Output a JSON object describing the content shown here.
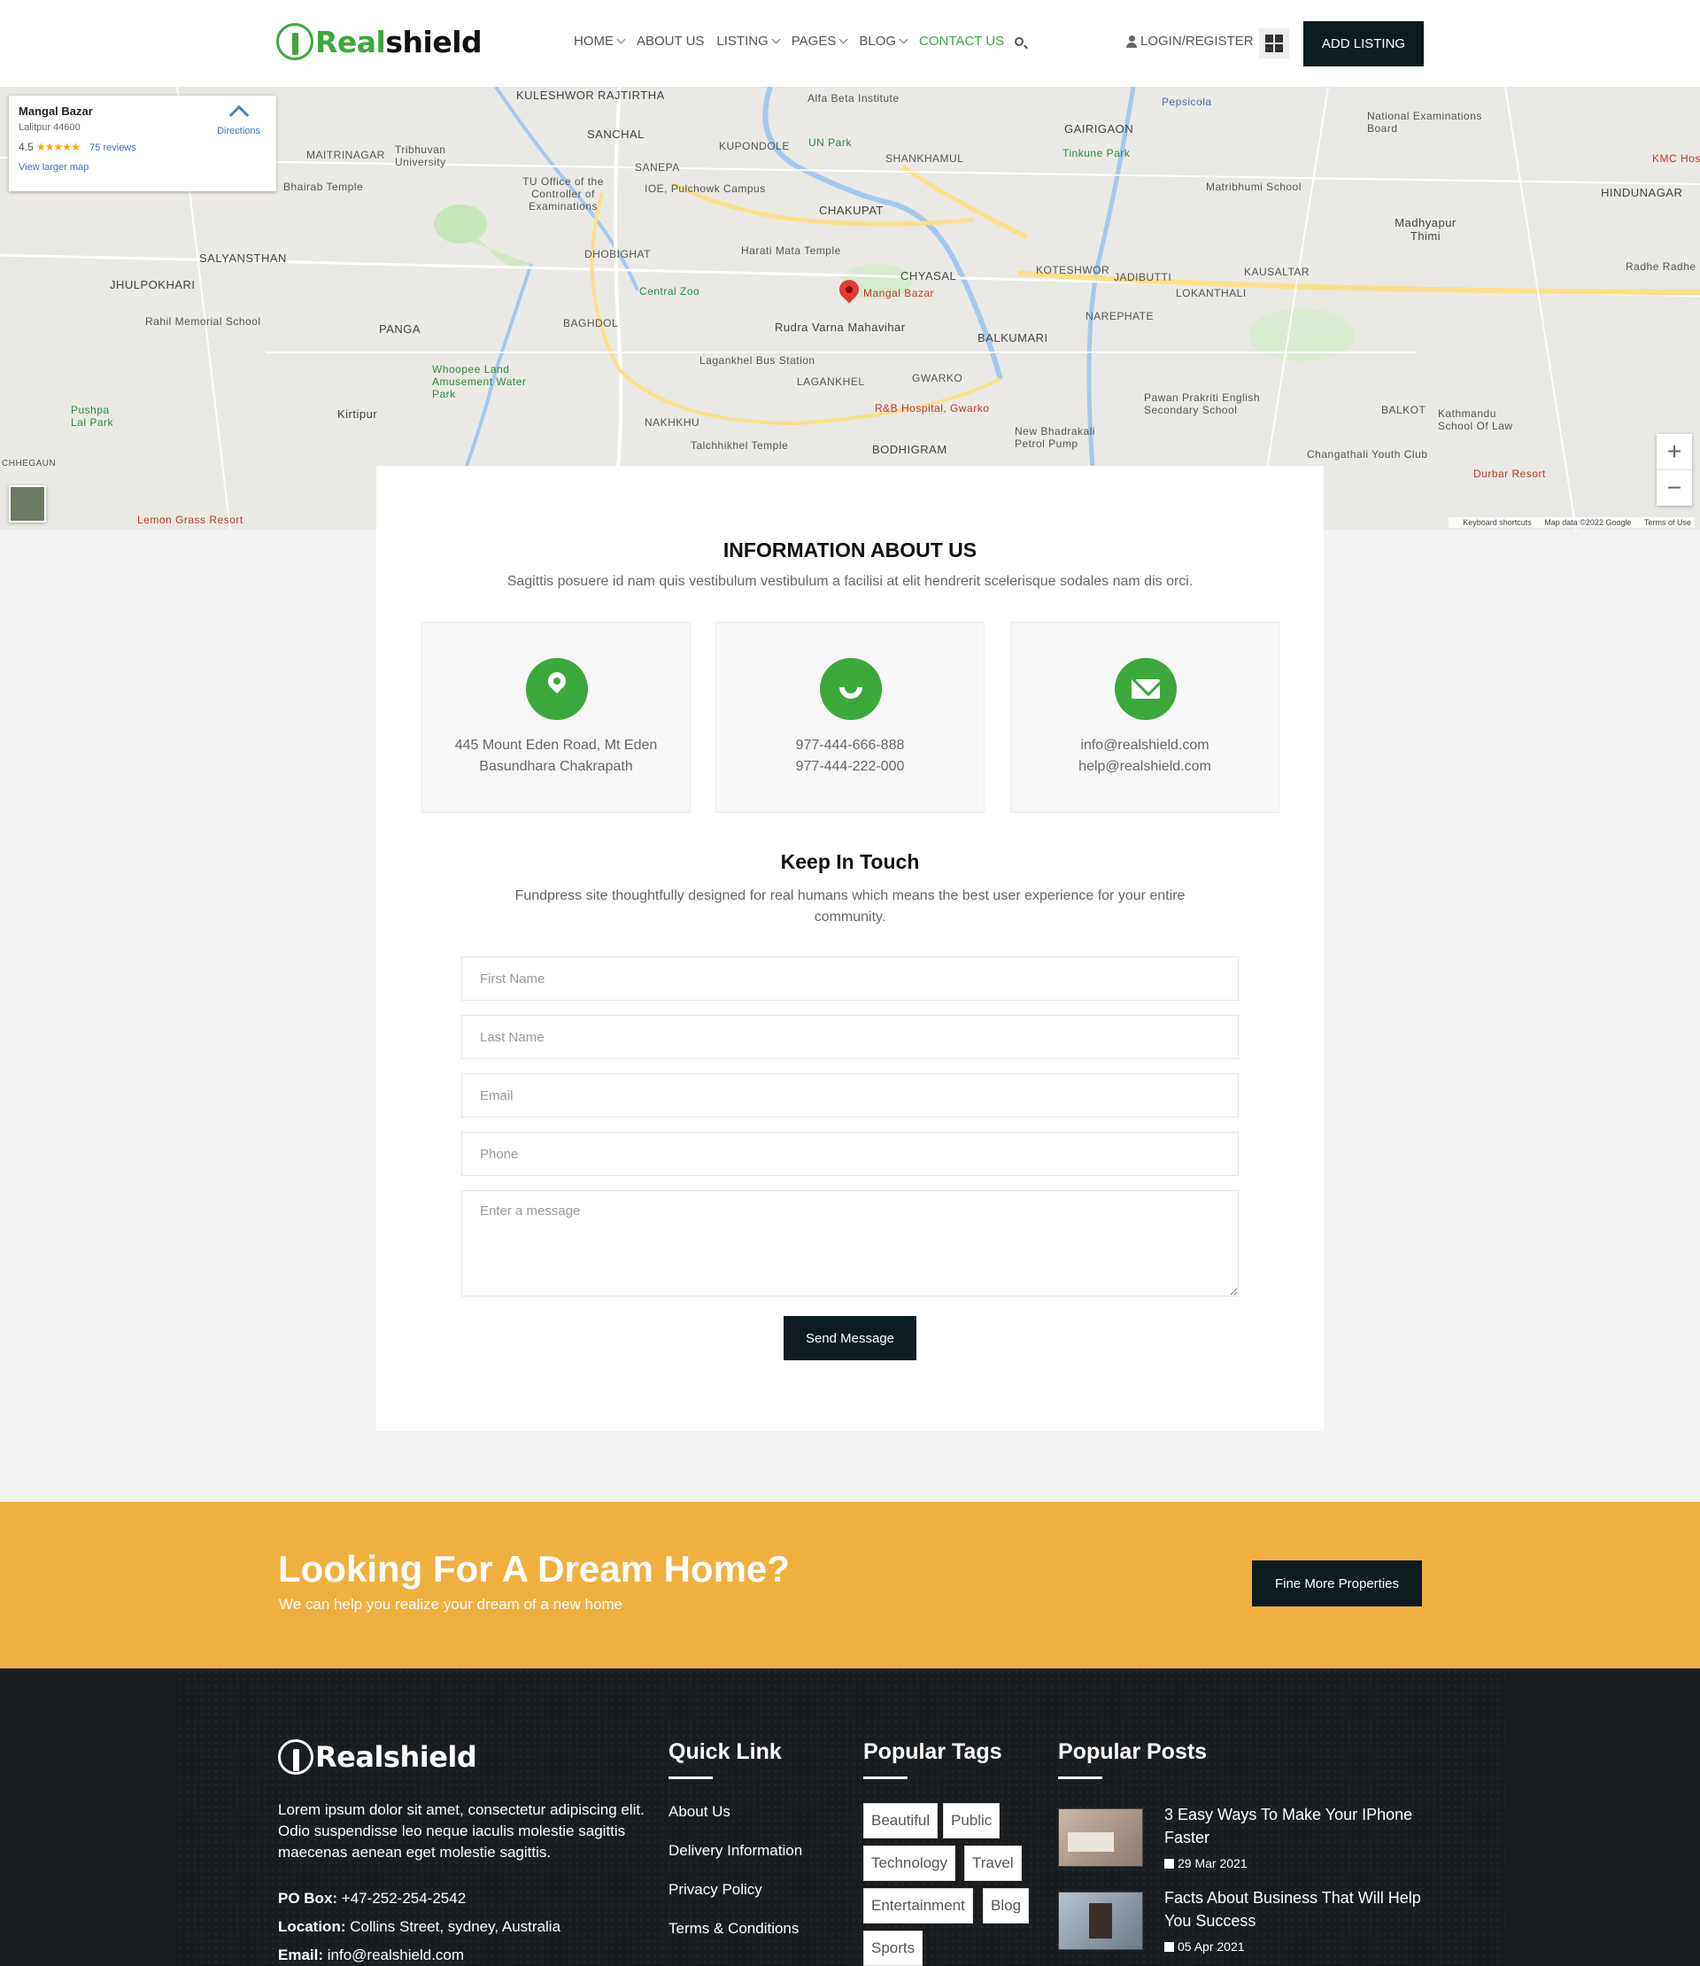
{
  "header": {
    "logo": {
      "green": "Real",
      "dark": "shield"
    },
    "nav": [
      {
        "label": "HOME",
        "dropdown": true
      },
      {
        "label": "ABOUT US",
        "dropdown": false
      },
      {
        "label": "LISTING",
        "dropdown": true
      },
      {
        "label": "PAGES",
        "dropdown": true
      },
      {
        "label": "BLOG",
        "dropdown": true
      },
      {
        "label": "CONTACT US",
        "dropdown": false,
        "active": true
      }
    ],
    "login_label": "LOGIN/REGISTER",
    "add_listing_label": "ADD LISTING"
  },
  "map": {
    "card": {
      "title": "Mangal Bazar",
      "address": "Lalitpur 44600",
      "rating": "4.5",
      "stars": "★★★★★",
      "reviews": "75 reviews",
      "larger_map": "View larger map",
      "directions": "Directions"
    },
    "pin_label": "Mangal Bazar",
    "labels": [
      "KULESHWOR",
      "RAJTIRTHA",
      "Alfa Beta Institute",
      "Pepsicola",
      "SANCHAL",
      "KUPONDOLE",
      "UN Park",
      "SHANKHAMUL",
      "GAIRIGAON",
      "National Examinations Board",
      "MAITRINAGAR",
      "Tribhuvan University",
      "Bhairab Temple",
      "SANEPA",
      "IOE, Pulchowk Campus",
      "Tinkune Park",
      "TU Office of the Controller of Examinations",
      "CHAKUPAT",
      "Matribhumi School",
      "HINDUNAGAR",
      "KMC Hos",
      "Madhyapur Thimi",
      "SALYANSTHAN",
      "DHOBIGHAT",
      "Harati Mata Temple",
      "CHYASAL",
      "KOTESHWOR",
      "JADIBUTTI",
      "KAUSALTAR",
      "Radhe Radhe",
      "JHULPOKHARI",
      "Central Zoo",
      "LOKANTHALI",
      "NAREPHATE",
      "Rahil Memorial School",
      "PANGA",
      "BAGHDOL",
      "Rudra Varna Mahavihar",
      "BALKUMARI",
      "Lagankhel Bus Station",
      "Whoopee Land Amusement Water Park",
      "LAGANKHEL",
      "GWARKO",
      "Pawan Prakriti English Secondary School",
      "Pushpa Lal Park",
      "Kirtipur",
      "R&B Hospital, Gwarko",
      "BALKOT",
      "Kathmandu School Of Law",
      "NAKHKHU",
      "New Bhadrakali Petrol Pump",
      "Talchhikhel Temple",
      "BODHIGRAM",
      "Changathali Youth Club",
      "CHHEGAUN",
      "Durbar Resort",
      "Lemon Grass Resort"
    ],
    "zoom_in": "+",
    "zoom_out": "−",
    "footer": [
      "Keyboard shortcuts",
      "Map data ©2022 Google",
      "Terms of Use"
    ]
  },
  "info": {
    "title": "INFORMATION ABOUT US",
    "subtitle": "Sagittis posuere id nam quis vestibulum vestibulum a facilisi at elit hendrerit scelerisque sodales nam dis orci.",
    "cards": [
      {
        "icon": "location-icon",
        "line1": "445 Mount Eden Road, Mt Eden",
        "line2": "Basundhara Chakrapath"
      },
      {
        "icon": "phone-icon",
        "line1": "977-444-666-888",
        "line2": "977-444-222-000"
      },
      {
        "icon": "email-icon",
        "line1": "info@realshield.com",
        "line2": "help@realshield.com"
      }
    ]
  },
  "contact": {
    "title": "Keep In Touch",
    "subtitle": "Fundpress site thoughtfully designed for real humans which means the best user experience for your entire community.",
    "fields": {
      "first_name": "First Name",
      "last_name": "Last Name",
      "email": "Email",
      "phone": "Phone",
      "message": "Enter a message"
    },
    "send_label": "Send Message"
  },
  "banner": {
    "title": "Looking For A Dream Home?",
    "subtitle": "We can help you realize your dream of a new home",
    "button": "Fine More Properties",
    "color": "#efb040"
  },
  "footer": {
    "logo": "Realshield",
    "description": "Lorem ipsum dolor sit amet, consectetur adipiscing elit. Odio suspendisse leo neque iaculis molestie sagittis maecenas aenean eget molestie sagittis.",
    "po_box_label": "PO Box:",
    "po_box": "+47-252-254-2542",
    "location_label": "Location:",
    "location": "Collins Street, sydney, Australia",
    "email_label": "Email:",
    "email": "info@realshield.com",
    "quick_link_title": "Quick Link",
    "quick_links": [
      "About Us",
      "Delivery Information",
      "Privacy Policy",
      "Terms & Conditions"
    ],
    "tags_title": "Popular Tags",
    "tags": [
      "Beautiful",
      "Public",
      "Technology",
      "Travel",
      "Entertainment",
      "Blog",
      "Sports"
    ],
    "posts_title": "Popular Posts",
    "posts": [
      {
        "title": "3 Easy Ways To Make Your IPhone Faster",
        "date": "29 Mar 2021"
      },
      {
        "title": "Facts About Business That Will Help You Success",
        "date": "05 Apr 2021"
      }
    ]
  },
  "colors": {
    "brand_green": "#3ca83c",
    "dark": "#0c1c21",
    "footer_bg": "#1a1d20"
  }
}
